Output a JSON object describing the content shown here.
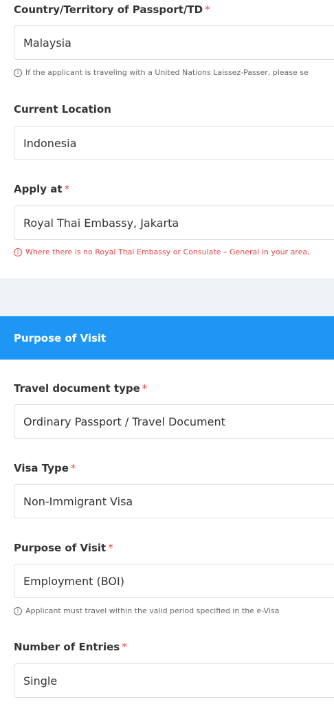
{
  "country_passport": {
    "label": "Country/Territory of Passport/TD",
    "required": "*",
    "value": "Malaysia",
    "hint": "If the applicant is traveling with a United Nations Laissez-Passer, please se"
  },
  "current_location": {
    "label": "Current Location",
    "value": "Indonesia"
  },
  "apply_at": {
    "label": "Apply at",
    "required": "*",
    "value": "Royal Thai Embassy, Jakarta",
    "hint": "Where there is no Royal Thai Embassy or Consulate – General in your area,"
  },
  "purpose_section": {
    "title": "Purpose of Visit",
    "color": "#1e96f3"
  },
  "travel_document_type": {
    "label": "Travel document type",
    "required": "*",
    "value": "Ordinary Passport / Travel Document"
  },
  "visa_type": {
    "label": "Visa Type",
    "required": "*",
    "value": "Non-Immigrant Visa"
  },
  "purpose_of_visit": {
    "label": "Purpose of Visit",
    "required": "*",
    "value": "Employment (BOI)",
    "hint": "Applicant must travel within the valid period specified in the e-Visa"
  },
  "number_of_entries": {
    "label": "Number of Entries",
    "required": "*",
    "value": "Single"
  },
  "icons": {
    "hint": "info-icon"
  }
}
